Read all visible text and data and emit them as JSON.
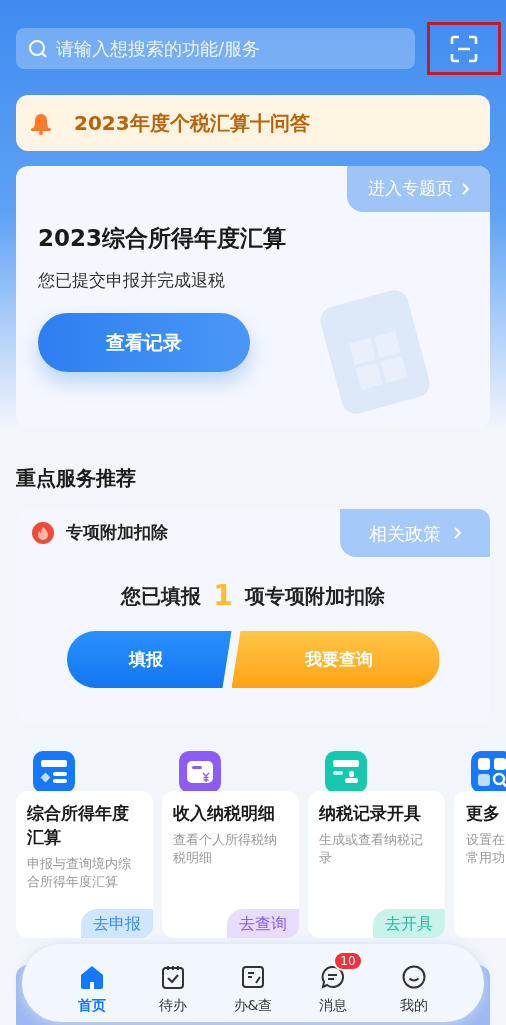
{
  "search": {
    "placeholder": "请输入想搜索的功能/服务",
    "scan_highlighted": true
  },
  "notice": {
    "text": "2023年度个税汇算十问答"
  },
  "hero": {
    "link": "进入专题页",
    "title": "2023综合所得年度汇算",
    "subtitle": "您已提交申报并完成退税",
    "button": "查看记录"
  },
  "section_title": "重点服务推荐",
  "service": {
    "title": "专项附加扣除",
    "link": "相关政策",
    "prefix": "您已填报",
    "count": "1",
    "suffix": "项专项附加扣除",
    "buttons": [
      "填报",
      "我要查询"
    ]
  },
  "cards": [
    {
      "kind": "annual",
      "color": "#1677ff",
      "title": "综合所得年度汇算",
      "desc": "申报与查询境内综合所得年度汇算",
      "action": "去申报"
    },
    {
      "kind": "income",
      "color": "#8b5cf6",
      "title": "收入纳税明细",
      "desc": "查看个人所得税纳税明细",
      "action": "去查询"
    },
    {
      "kind": "record",
      "color": "#14c9b0",
      "title": "纳税记录开具",
      "desc": "生成或查看纳税记录",
      "action": "去开具"
    },
    {
      "kind": "more",
      "color": "#1677ff",
      "title": "更多",
      "desc_lines": [
        "设置在",
        "常用功"
      ]
    }
  ],
  "nav": [
    {
      "kind": "home",
      "label": "首页",
      "selected": true
    },
    {
      "kind": "todo",
      "label": "待办",
      "selected": false
    },
    {
      "kind": "query",
      "label": "办&查",
      "selected": false
    },
    {
      "kind": "message",
      "label": "消息",
      "selected": false,
      "badge": "10"
    },
    {
      "kind": "mine",
      "label": "我的",
      "selected": false
    }
  ]
}
